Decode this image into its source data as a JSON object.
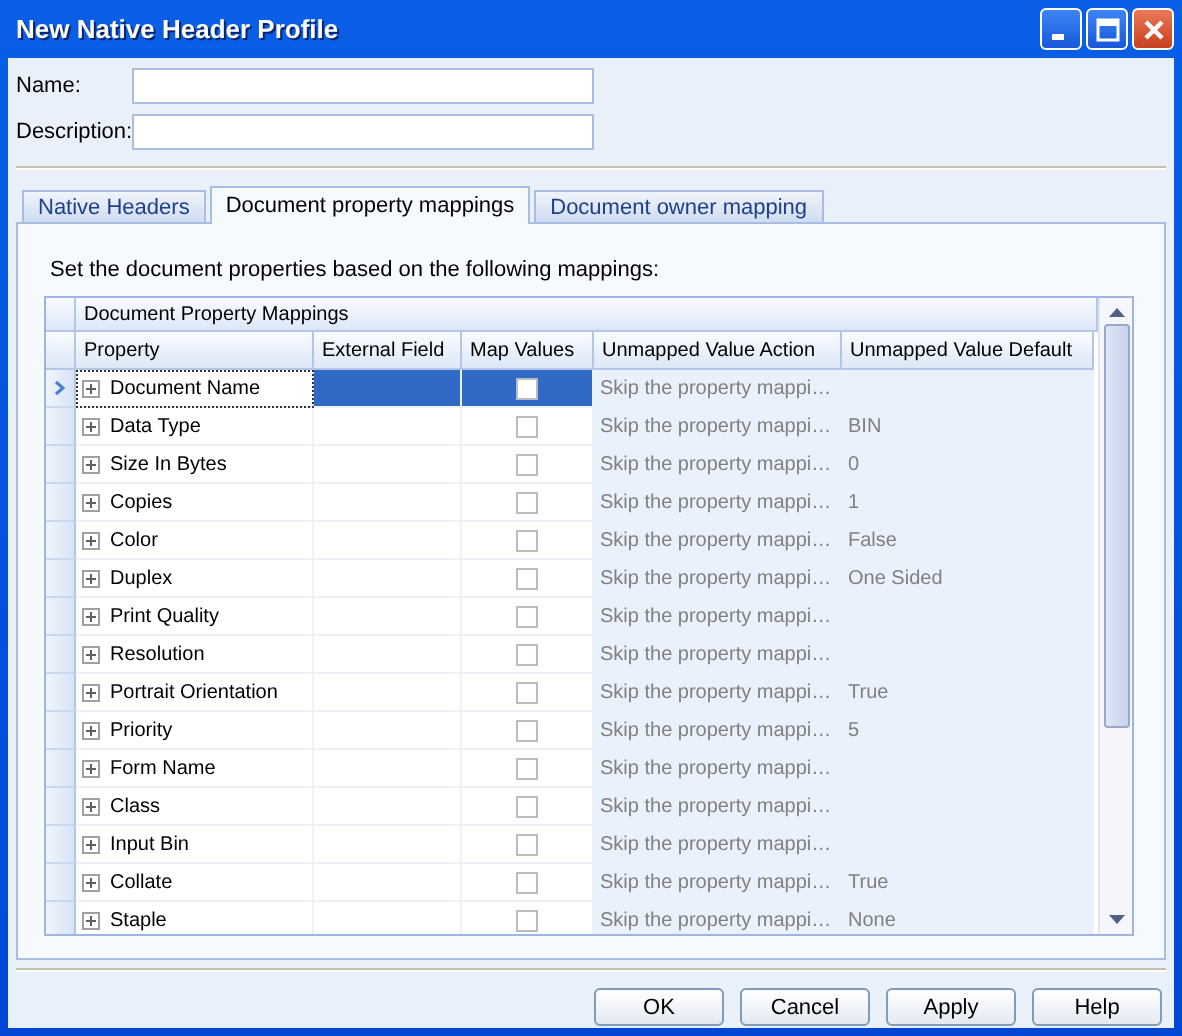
{
  "window": {
    "title": "New Native Header Profile"
  },
  "fields": [
    {
      "label": "Name:"
    },
    {
      "label": "Description:"
    }
  ],
  "tabs": [
    {
      "label": "Native Headers",
      "selected": false
    },
    {
      "label": "Document property mappings",
      "selected": true
    },
    {
      "label": "Document owner mapping",
      "selected": false
    }
  ],
  "instruction": "Set the document properties based on the following mappings:",
  "grid": {
    "group_title": "Document Property Mappings",
    "columns": [
      "Property",
      "External Field",
      "Map Values",
      "Unmapped Value Action",
      "Unmapped Value Default"
    ],
    "rows": [
      {
        "property": "Document Name",
        "selected": true,
        "map_values": false,
        "action": "Skip the property mappi…"
      },
      {
        "property": "Data Type",
        "selected": false,
        "map_values": false,
        "action": "Skip the property mappi…",
        "default": "BIN"
      },
      {
        "property": "Size In Bytes",
        "selected": false,
        "map_values": false,
        "action": "Skip the property mappi…",
        "default": "0"
      },
      {
        "property": "Copies",
        "selected": false,
        "map_values": false,
        "action": "Skip the property mappi…",
        "default": "1"
      },
      {
        "property": "Color",
        "selected": false,
        "map_values": false,
        "action": "Skip the property mappi…",
        "default": "False"
      },
      {
        "property": "Duplex",
        "selected": false,
        "map_values": false,
        "action": "Skip the property mappi…",
        "default": "One Sided"
      },
      {
        "property": "Print Quality",
        "selected": false,
        "map_values": false,
        "action": "Skip the property mappi…"
      },
      {
        "property": "Resolution",
        "selected": false,
        "map_values": false,
        "action": "Skip the property mappi…"
      },
      {
        "property": "Portrait Orientation",
        "selected": false,
        "map_values": false,
        "action": "Skip the property mappi…",
        "default": "True"
      },
      {
        "property": "Priority",
        "selected": false,
        "map_values": false,
        "action": "Skip the property mappi…",
        "default": "5"
      },
      {
        "property": "Form Name",
        "selected": false,
        "map_values": false,
        "action": "Skip the property mappi…"
      },
      {
        "property": "Class",
        "selected": false,
        "map_values": false,
        "action": "Skip the property mappi…"
      },
      {
        "property": "Input Bin",
        "selected": false,
        "map_values": false,
        "action": "Skip the property mappi…"
      },
      {
        "property": "Collate",
        "selected": false,
        "map_values": false,
        "action": "Skip the property mappi…",
        "default": "True"
      },
      {
        "property": "Staple",
        "selected": false,
        "map_values": false,
        "action": "Skip the property mappi…",
        "default": "None"
      }
    ]
  },
  "buttons": [
    "OK",
    "Cancel",
    "Apply",
    "Help"
  ]
}
